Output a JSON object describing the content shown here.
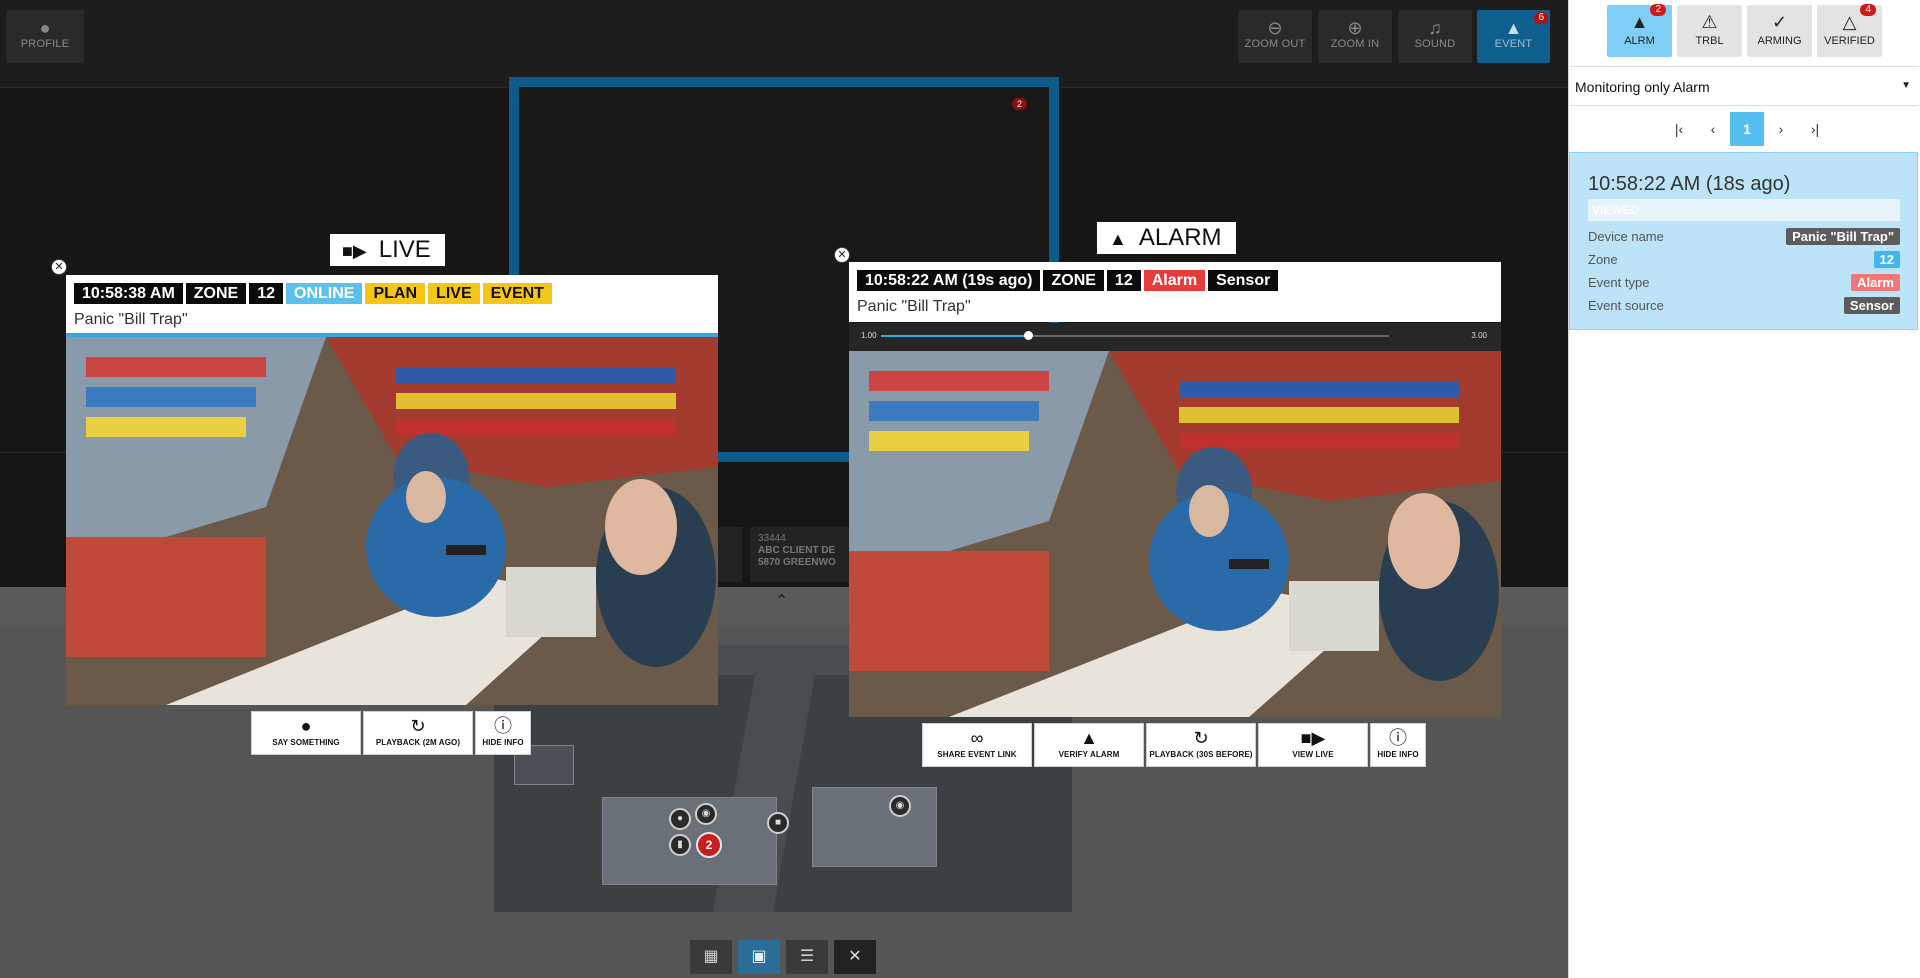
{
  "topbar": {
    "profile_label": "PROFILE",
    "zoom_out_label": "ZOOM OUT",
    "zoom_in_label": "ZOOM IN",
    "sound_label": "SOUND",
    "event_label": "EVENT",
    "event_badge": "6"
  },
  "plan": {
    "badge": "2"
  },
  "client_card": {
    "line1": "33444",
    "line2": "ABC CLIENT DE",
    "line3": "5870 GREENWO"
  },
  "map": {
    "alarm_count": "2"
  },
  "live_cam": {
    "title": "LIVE",
    "time": "10:58:38 AM",
    "zone_label": "ZONE",
    "zone_value": "12",
    "tags": [
      "ONLINE",
      "PLAN",
      "LIVE",
      "EVENT"
    ],
    "device": "Panic \"Bill Trap\"",
    "actions": [
      "SAY SOMETHING",
      "PLAYBACK (2M AGO)",
      "HIDE INFO"
    ]
  },
  "alarm_cam": {
    "title": "ALARM",
    "time": "10:58:22 AM (19s ago)",
    "zone_label": "ZONE",
    "zone_value": "12",
    "type": "Alarm",
    "source": "Sensor",
    "device": "Panic \"Bill Trap\"",
    "scrub_start": "1.00",
    "scrub_end": "3.00",
    "scrub_progress": 0.29,
    "actions": [
      "SHARE EVENT LINK",
      "VERIFY ALARM",
      "PLAYBACK (30S BEFORE)",
      "VIEW LIVE",
      "HIDE INFO"
    ]
  },
  "side": {
    "tabs": [
      {
        "label": "ALRM",
        "badge": "2",
        "icon": "bell-icon"
      },
      {
        "label": "TRBL",
        "badge": "",
        "icon": "exclamation-icon"
      },
      {
        "label": "ARMING",
        "badge": "",
        "icon": "shield-check-icon"
      },
      {
        "label": "VERIFIED",
        "badge": "4",
        "icon": "sensor-icon"
      }
    ],
    "filter": "Monitoring only Alarm",
    "page": "1",
    "event": {
      "time": "10:58:22 AM (18s ago)",
      "status": "VIEWED",
      "device_name_label": "Device name",
      "device_name": "Panic \"Bill Trap\"",
      "zone_label": "Zone",
      "zone": "12",
      "event_type_label": "Event type",
      "event_type": "Alarm",
      "event_source_label": "Event source",
      "event_source": "Sensor"
    }
  },
  "colors": {
    "accent": "#35a7e0",
    "alarm": "#e83b3b",
    "warning": "#f5c518",
    "online": "#5bc0eb"
  }
}
